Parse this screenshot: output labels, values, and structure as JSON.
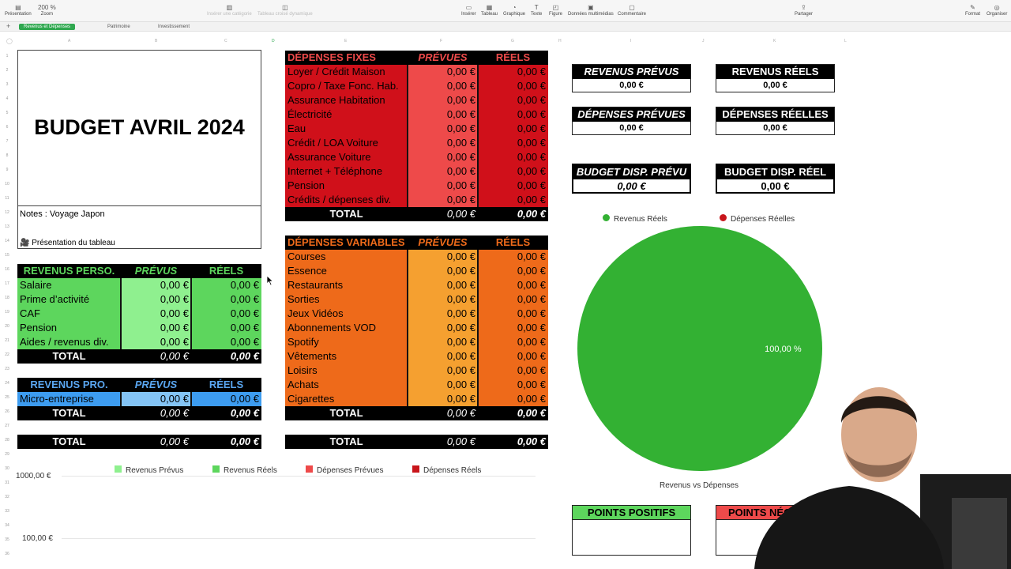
{
  "toolbar": {
    "left": [
      {
        "icon": "sidebar-icon",
        "label": "Présentation"
      },
      {
        "icon": "zoom-icon",
        "label": "Zoom",
        "value": "200 %"
      }
    ],
    "dim": [
      {
        "label": "Insérer une catégorie"
      },
      {
        "label": "Tableau croisé dynamique"
      }
    ],
    "center": [
      {
        "icon": "insert-icon",
        "label": "Insérer"
      },
      {
        "icon": "table-icon",
        "label": "Tableau"
      },
      {
        "icon": "chart-icon",
        "label": "Graphique"
      },
      {
        "icon": "text-icon",
        "label": "Texte"
      },
      {
        "icon": "shape-icon",
        "label": "Figure"
      },
      {
        "icon": "media-icon",
        "label": "Données multimédias"
      },
      {
        "icon": "comment-icon",
        "label": "Commentaire"
      }
    ],
    "share": {
      "icon": "share-icon",
      "label": "Partager"
    },
    "right": [
      {
        "icon": "format-icon",
        "label": "Format"
      },
      {
        "icon": "organize-icon",
        "label": "Organiser"
      }
    ]
  },
  "tabs": [
    "Revenus et Dépenses",
    "Patrimoine",
    "Investissement"
  ],
  "columns": [
    "A",
    "B",
    "C",
    "D",
    "E",
    "F",
    "G",
    "H",
    "I",
    "J",
    "K",
    "L"
  ],
  "rows": [
    "1",
    "2",
    "3",
    "4",
    "5",
    "6",
    "7",
    "8",
    "9",
    "10",
    "11",
    "12",
    "13",
    "14",
    "15",
    "16",
    "17",
    "18",
    "19",
    "20",
    "21",
    "22",
    "23",
    "24",
    "25",
    "26",
    "27",
    "28",
    "29",
    "30",
    "31",
    "32",
    "33",
    "34",
    "35",
    "36",
    "37",
    "38"
  ],
  "title_card": {
    "title": "BUDGET AVRIL 2024",
    "notes": "Notes : Voyage Japon",
    "presentation": "Présentation du tableau"
  },
  "revenus_perso": {
    "headers": [
      "REVENUS PERSO.",
      "PRÉVUS",
      "RÉELS"
    ],
    "rows": [
      [
        "Salaire",
        "0,00 €",
        "0,00 €"
      ],
      [
        "Prime d’activité",
        "0,00 €",
        "0,00 €"
      ],
      [
        "CAF",
        "0,00 €",
        "0,00 €"
      ],
      [
        "Pension",
        "0,00 €",
        "0,00 €"
      ],
      [
        "Aides / revenus div.",
        "0,00 €",
        "0,00 €"
      ]
    ],
    "total": [
      "TOTAL",
      "0,00 €",
      "0,00 €"
    ]
  },
  "revenus_pro": {
    "headers": [
      "REVENUS PRO.",
      "PRÉVUS",
      "RÉELS"
    ],
    "rows": [
      [
        "Micro-entreprise",
        "0,00 €",
        "0,00 €"
      ]
    ],
    "total": [
      "TOTAL",
      "0,00 €",
      "0,00 €"
    ]
  },
  "grand_total_left": [
    "TOTAL",
    "0,00 €",
    "0,00 €"
  ],
  "depenses_fixes": {
    "headers": [
      "DÉPENSES FIXES",
      "PRÉVUES",
      "RÉELS"
    ],
    "rows": [
      [
        "Loyer / Crédit Maison",
        "0,00 €",
        "0,00 €"
      ],
      [
        "Copro / Taxe Fonc. Hab.",
        "0,00 €",
        "0,00 €"
      ],
      [
        "Assurance Habitation",
        "0,00 €",
        "0,00 €"
      ],
      [
        "Électricité",
        "0,00 €",
        "0,00 €"
      ],
      [
        "Eau",
        "0,00 €",
        "0,00 €"
      ],
      [
        "Crédit / LOA Voiture",
        "0,00 €",
        "0,00 €"
      ],
      [
        "Assurance Voiture",
        "0,00 €",
        "0,00 €"
      ],
      [
        "Internet + Téléphone",
        "0,00 €",
        "0,00 €"
      ],
      [
        "Pension",
        "0,00 €",
        "0,00 €"
      ],
      [
        "Crédits / dépenses div.",
        "0,00 €",
        "0,00 €"
      ]
    ],
    "total": [
      "TOTAL",
      "0,00 €",
      "0,00 €"
    ]
  },
  "depenses_variables": {
    "headers": [
      "DÉPENSES VARIABLES",
      "PRÉVUES",
      "RÉELS"
    ],
    "rows": [
      [
        "Courses",
        "0,00 €",
        "0,00 €"
      ],
      [
        "Essence",
        "0,00 €",
        "0,00 €"
      ],
      [
        "Restaurants",
        "0,00 €",
        "0,00 €"
      ],
      [
        "Sorties",
        "0,00 €",
        "0,00 €"
      ],
      [
        "Jeux Vidéos",
        "0,00 €",
        "0,00 €"
      ],
      [
        "Abonnements VOD",
        "0,00 €",
        "0,00 €"
      ],
      [
        "Spotify",
        "0,00 €",
        "0,00 €"
      ],
      [
        "Vêtements",
        "0,00 €",
        "0,00 €"
      ],
      [
        "Loisirs",
        "0,00 €",
        "0,00 €"
      ],
      [
        "Achats",
        "0,00 €",
        "0,00 €"
      ],
      [
        "Cigarettes",
        "0,00 €",
        "0,00 €"
      ]
    ],
    "total": [
      "TOTAL",
      "0,00 €",
      "0,00 €"
    ]
  },
  "grand_total_mid": [
    "TOTAL",
    "0,00 €",
    "0,00 €"
  ],
  "summary": {
    "revenus_prevus": {
      "title": "REVENUS PRÉVUS",
      "value": "0,00 €"
    },
    "revenus_reels": {
      "title": "REVENUS RÉELS",
      "value": "0,00 €"
    },
    "depenses_prevues": {
      "title": "DÉPENSES PRÉVUES",
      "value": "0,00 €"
    },
    "depenses_reelles": {
      "title": "DÉPENSES RÉELLES",
      "value": "0,00 €"
    },
    "budget_prevu": {
      "title": "BUDGET DISP. PRÉVU",
      "value": "0,00 €"
    },
    "budget_reel": {
      "title": "BUDGET DISP. RÉEL",
      "value": "0,00 €"
    }
  },
  "points": {
    "positifs": "POINTS POSITIFS",
    "negatifs": "POINTS NÉG"
  },
  "colors": {
    "green_dark": "#2db52d",
    "green_mid": "#5dd65d",
    "green_light": "#8ff08f",
    "blue_header": "#5aa6f0",
    "blue_row": "#3d9cf0",
    "blue_light": "#84c4f5",
    "red_dark": "#d0101a",
    "red_light": "#ee4a4a",
    "orange_dark": "#ee6a1a",
    "orange_light": "#f5a030",
    "pie_green": "#33b133",
    "pie_red": "#c8151b"
  },
  "chart_data": [
    {
      "type": "pie",
      "title": "Revenus vs Dépenses",
      "legend": [
        "Revenus Réels",
        "Dépenses Réelles"
      ],
      "legend_position": "top",
      "series": [
        {
          "name": "Revenus Réels",
          "value": 100.0,
          "label": "100,00 %"
        },
        {
          "name": "Dépenses Réelles",
          "value": 0.0
        }
      ]
    },
    {
      "type": "bar",
      "legend": [
        "Revenus Prévus",
        "Revenus Réels",
        "Dépenses Prévues",
        "Dépenses Réels"
      ],
      "legend_position": "top",
      "y_ticks": [
        "1000,00 €",
        "100,00 €"
      ],
      "series": [
        {
          "name": "Revenus Prévus",
          "values": []
        },
        {
          "name": "Revenus Réels",
          "values": []
        },
        {
          "name": "Dépenses Prévues",
          "values": []
        },
        {
          "name": "Dépenses Réels",
          "values": []
        }
      ]
    }
  ]
}
